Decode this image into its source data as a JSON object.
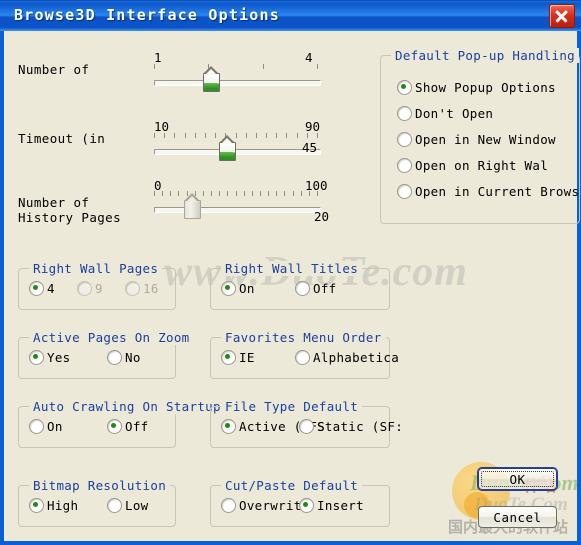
{
  "window": {
    "title": "Browse3D Interface Options",
    "close_label": "close-icon",
    "bg_color": "#ece9d8",
    "titlebar_color": "#0d56c8",
    "group_title_color": "#1b3fa0",
    "accent_color": "#1f8a14"
  },
  "sliders": [
    {
      "label": "Number of",
      "min_label": "1",
      "max_label": "4",
      "value": 2,
      "min": 1,
      "max": 4,
      "value_text": "",
      "ticks": 4,
      "disabled": false
    },
    {
      "label": "Timeout (in",
      "min_label": "10",
      "max_label": "90",
      "value": 45,
      "min": 10,
      "max": 90,
      "value_text": "45",
      "ticks": 17,
      "disabled": false
    },
    {
      "label": "Number of History Pages",
      "min_label": "0",
      "max_label": "100",
      "value": 20,
      "min": 0,
      "max": 100,
      "value_text": "20",
      "ticks": 21,
      "disabled": true
    }
  ],
  "popup_group": {
    "title": "Default Pop-up Handling",
    "options": [
      {
        "label": "Show Popup Options",
        "selected": true
      },
      {
        "label": "Don't Open",
        "selected": false
      },
      {
        "label": "Open in New Window",
        "selected": false
      },
      {
        "label": "Open on Right Wal",
        "selected": false
      },
      {
        "label": "Open in Current Brows",
        "selected": false
      }
    ]
  },
  "groups": [
    {
      "title": "Right Wall Pages",
      "options": [
        {
          "label": "4",
          "selected": true,
          "disabled": false
        },
        {
          "label": "9",
          "selected": false,
          "disabled": true
        },
        {
          "label": "16",
          "selected": false,
          "disabled": true
        }
      ]
    },
    {
      "title": "Right Wall Titles",
      "options": [
        {
          "label": "On",
          "selected": true,
          "disabled": false
        },
        {
          "label": "Off",
          "selected": false,
          "disabled": false
        }
      ]
    },
    {
      "title": "Active Pages On Zoom",
      "options": [
        {
          "label": "Yes",
          "selected": true,
          "disabled": false
        },
        {
          "label": "No",
          "selected": false,
          "disabled": false
        }
      ]
    },
    {
      "title": "Favorites Menu Order",
      "options": [
        {
          "label": "IE",
          "selected": true,
          "disabled": false
        },
        {
          "label": "Alphabetica",
          "selected": false,
          "disabled": false
        }
      ]
    },
    {
      "title": "Auto Crawling On Startup",
      "options": [
        {
          "label": "On",
          "selected": false,
          "disabled": false
        },
        {
          "label": "Off",
          "selected": true,
          "disabled": false
        }
      ]
    },
    {
      "title": "File Type Default",
      "options": [
        {
          "label": "Active (AFS",
          "selected": true,
          "disabled": false
        },
        {
          "label": "Static (SF:",
          "selected": false,
          "disabled": false
        }
      ]
    },
    {
      "title": "Bitmap Resolution",
      "options": [
        {
          "label": "High",
          "selected": true,
          "disabled": false
        },
        {
          "label": "Low",
          "selected": false,
          "disabled": false
        }
      ]
    },
    {
      "title": "Cut/Paste Default",
      "options": [
        {
          "label": "Overwrite",
          "selected": false,
          "disabled": false
        },
        {
          "label": "Insert",
          "selected": true,
          "disabled": false
        }
      ]
    }
  ],
  "buttons": {
    "ok": "OK",
    "cancel": "Cancel"
  },
  "watermark": {
    "url": "www.DuoTe.com",
    "brand": "DuoTe.Com",
    "cn_top": "件站",
    "cn_bottom": "国内最大的软件站"
  }
}
